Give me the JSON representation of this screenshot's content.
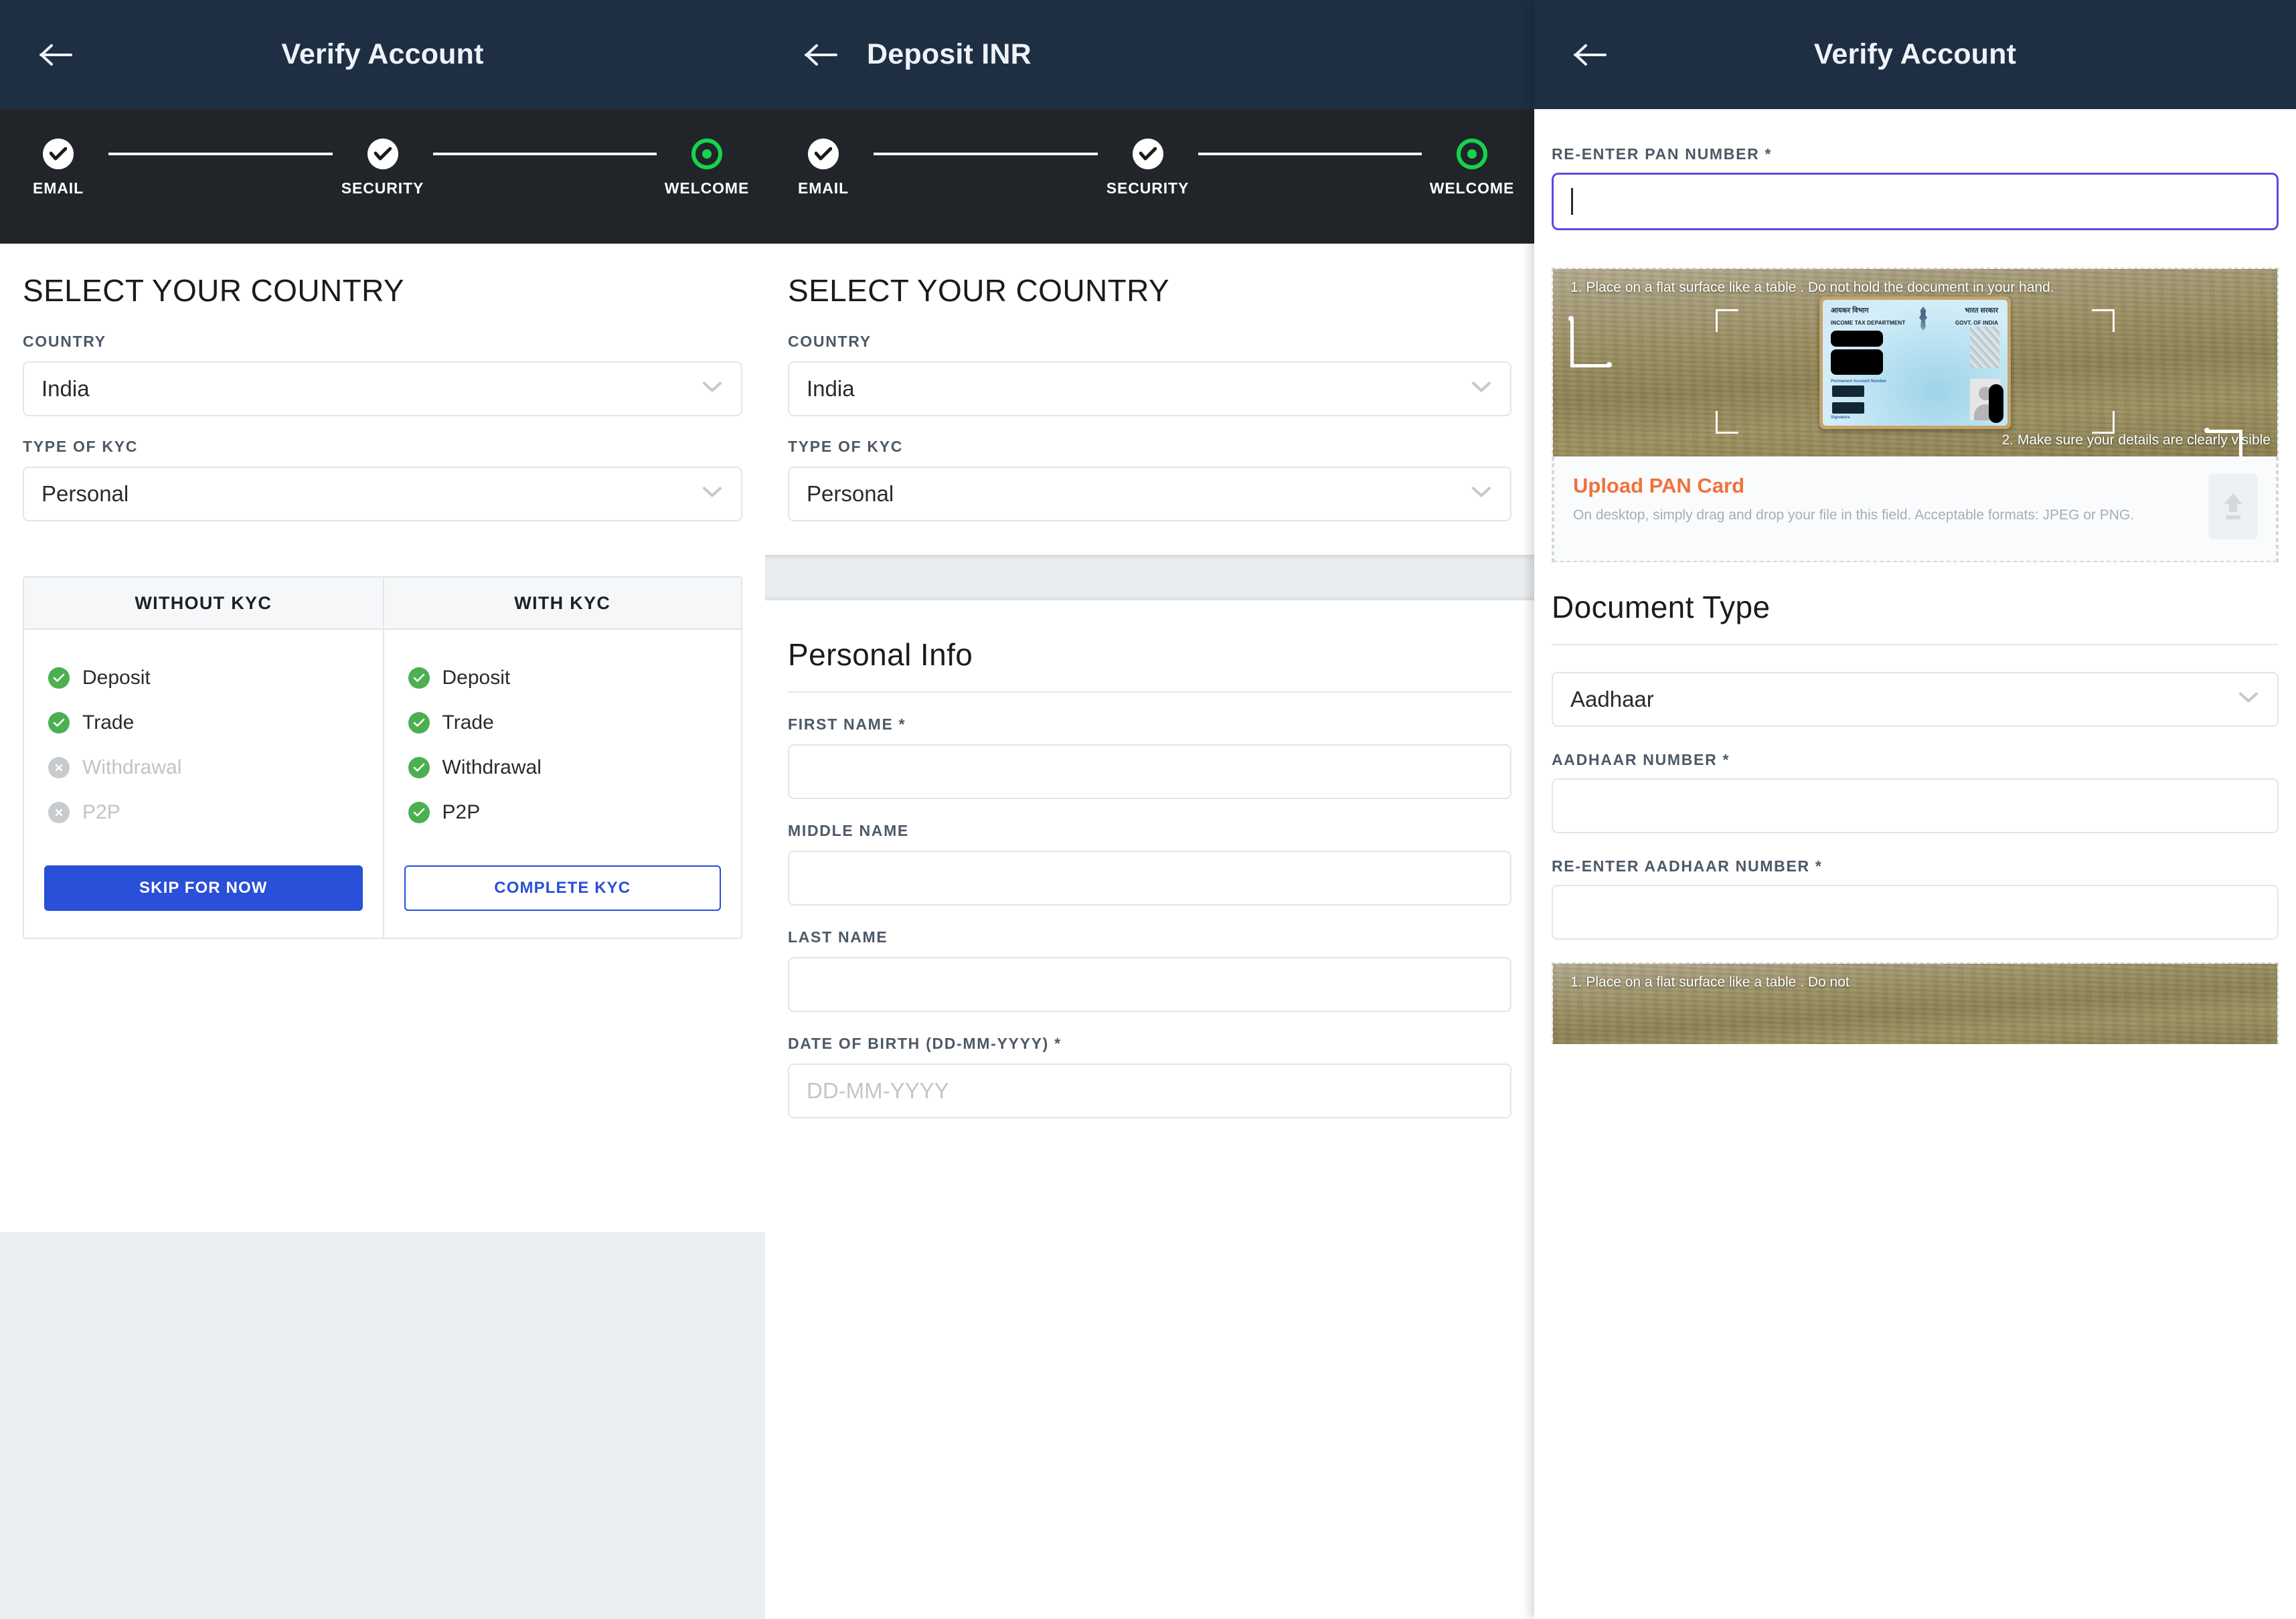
{
  "panels": {
    "left": {
      "appbar": {
        "title": "Verify Account",
        "back_icon": "arrow-left-icon"
      },
      "stepper": {
        "steps": [
          {
            "label": "EMAIL",
            "state": "done"
          },
          {
            "label": "SECURITY",
            "state": "done"
          },
          {
            "label": "WELCOME",
            "state": "current"
          }
        ],
        "accent_color": "#15d44b"
      },
      "section_title": "SELECT YOUR COUNTRY",
      "country": {
        "label": "COUNTRY",
        "value": "India"
      },
      "kyc_type": {
        "label": "TYPE OF KYC",
        "value": "Personal"
      },
      "kyc_table": {
        "columns": [
          {
            "header": "WITHOUT KYC",
            "items": [
              {
                "label": "Deposit",
                "allowed": true
              },
              {
                "label": "Trade",
                "allowed": true
              },
              {
                "label": "Withdrawal",
                "allowed": false
              },
              {
                "label": "P2P",
                "allowed": false
              }
            ],
            "button": {
              "label": "SKIP FOR NOW",
              "style": "primary",
              "color": "#2a4fd8"
            }
          },
          {
            "header": "WITH KYC",
            "items": [
              {
                "label": "Deposit",
                "allowed": true
              },
              {
                "label": "Trade",
                "allowed": true
              },
              {
                "label": "Withdrawal",
                "allowed": true
              },
              {
                "label": "P2P",
                "allowed": true
              }
            ],
            "button": {
              "label": "COMPLETE KYC",
              "style": "outline",
              "color": "#2a4fd8"
            }
          }
        ]
      }
    },
    "middle": {
      "appbar": {
        "title": "Deposit INR",
        "back_icon": "arrow-left-icon"
      },
      "stepper": {
        "steps": [
          {
            "label": "EMAIL",
            "state": "done"
          },
          {
            "label": "SECURITY",
            "state": "done"
          },
          {
            "label": "WELCOME",
            "state": "current"
          }
        ]
      },
      "section_title": "SELECT YOUR COUNTRY",
      "country": {
        "label": "COUNTRY",
        "value": "India"
      },
      "kyc_type": {
        "label": "TYPE OF KYC",
        "value": "Personal"
      },
      "personal_info": {
        "heading": "Personal Info",
        "fields": [
          {
            "label": "FIRST NAME *",
            "value": "",
            "placeholder": ""
          },
          {
            "label": "MIDDLE NAME",
            "value": "",
            "placeholder": ""
          },
          {
            "label": "LAST NAME",
            "value": "",
            "placeholder": ""
          },
          {
            "label": "DATE OF BIRTH (DD-MM-YYYY) *",
            "value": "",
            "placeholder": "DD-MM-YYYY"
          }
        ]
      }
    },
    "right": {
      "appbar": {
        "title": "Verify Account",
        "back_icon": "arrow-left-icon"
      },
      "pan_reenter": {
        "label": "RE-ENTER PAN NUMBER *",
        "value": "",
        "focused": true,
        "focus_color": "#5a4be0"
      },
      "pan_preview": {
        "note_1": "1. Place on a flat surface like a table . Do not hold the document in your hand.",
        "note_2": "2. Make sure your details are clearly visible",
        "card": {
          "hindi_left": "आयकर विभाग",
          "hindi_right": "भारत सरकार",
          "english_left": "INCOME TAX DEPARTMENT",
          "english_right": "GOVT. OF INDIA",
          "pan_label": "Permanent Account Number",
          "signature_label": "Signature"
        }
      },
      "upload": {
        "title": "Upload PAN Card",
        "description": "On desktop, simply drag and drop your file in this field. Acceptable formats: JPEG or PNG.",
        "icon": "upload-icon",
        "accent_color": "#f0713f"
      },
      "document_type": {
        "heading": "Document Type",
        "select": {
          "value": "Aadhaar"
        },
        "fields": [
          {
            "label": "AADHAAR NUMBER *",
            "value": ""
          },
          {
            "label": "RE-ENTER AADHAAR NUMBER *",
            "value": ""
          }
        ]
      },
      "second_preview": {
        "note_1": "1. Place on a flat surface like a table . Do not"
      }
    }
  }
}
